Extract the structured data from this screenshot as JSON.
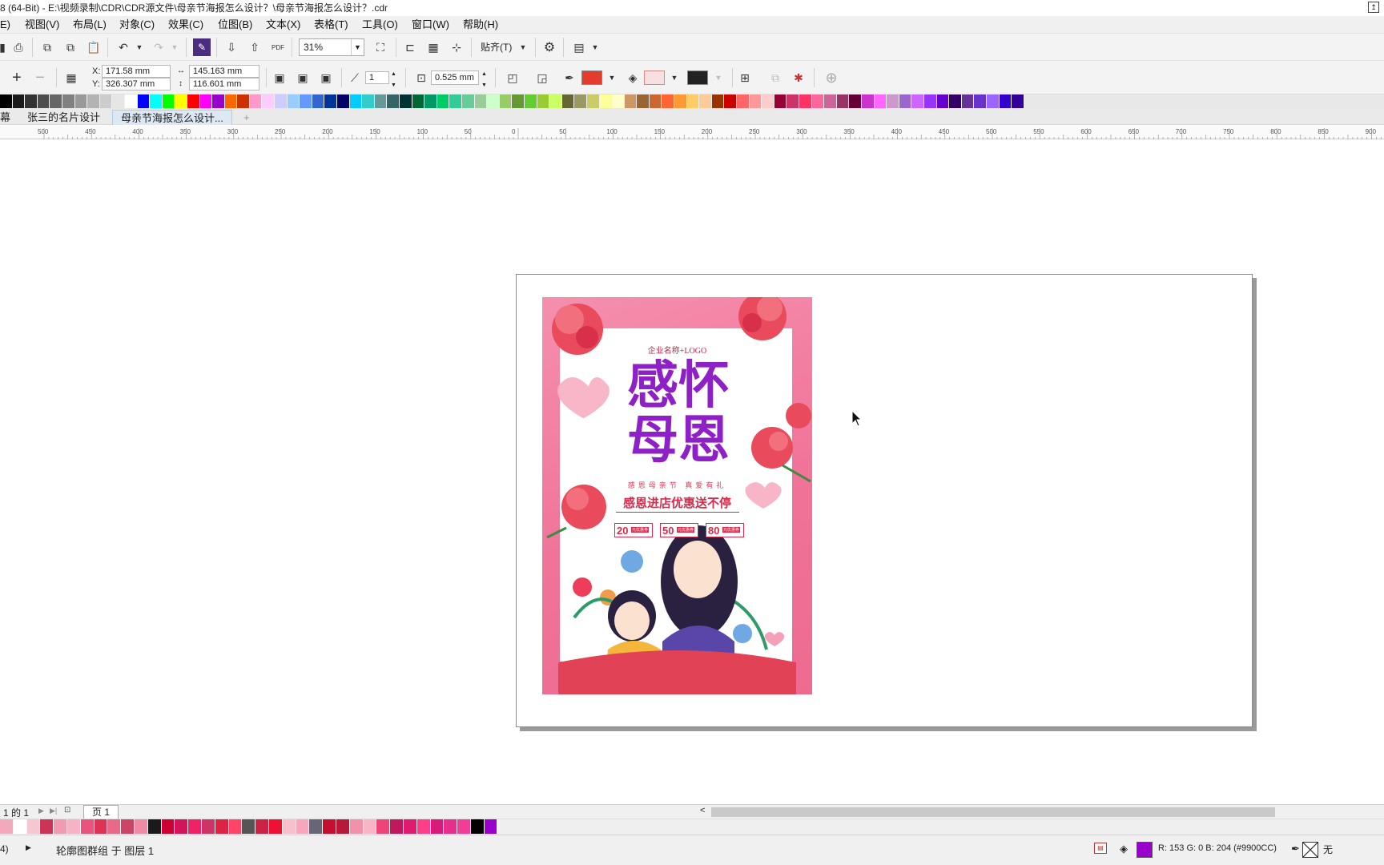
{
  "window": {
    "title": "8 (64-Bit) - E:\\视频录制\\CDR\\CDR源文件\\母亲节海报怎么设计？\\母亲节海报怎么设计？.cdr"
  },
  "menu": [
    "E)",
    "视图(V)",
    "布局(L)",
    "对象(C)",
    "效果(C)",
    "位图(B)",
    "文本(X)",
    "表格(T)",
    "工具(O)",
    "窗口(W)",
    "帮助(H)"
  ],
  "toolbar": {
    "zoom": "31%",
    "snap_label": "贴齐(T)",
    "pdf_label": "PDF"
  },
  "property_bar": {
    "x_label": "X:",
    "x_value": "171.58 mm",
    "y_label": "Y:",
    "y_value": "326.307 mm",
    "width_value": "145.163 mm",
    "height_value": "116.601 mm",
    "spin_value": "1",
    "outline_width": "0.525 mm",
    "fill_color": "#e43b2c",
    "outline_color": "#f4c7c7",
    "extra_color": "#222222"
  },
  "doc_tabs": {
    "tab1": "幕",
    "tab2": "张三的名片设计",
    "tab3": "母亲节海报怎么设计...",
    "add": "+"
  },
  "ruler": [
    "500",
    "450",
    "400",
    "350",
    "300",
    "250",
    "200",
    "150",
    "100",
    "50",
    "0",
    "50",
    "100",
    "150",
    "200",
    "250",
    "300",
    "350",
    "400",
    "450",
    "500",
    "550",
    "600",
    "650",
    "700",
    "750",
    "800",
    "850",
    "900"
  ],
  "poster": {
    "company": "企业名称+LOGO",
    "headline_line1": "感怀",
    "headline_line2": "母恩",
    "subline": "感恩母亲节  真爱有礼",
    "slogan": "感恩进店优惠送不停",
    "coupons": [
      {
        "amount": "20",
        "text": "元优惠券"
      },
      {
        "amount": "50",
        "text": "元优惠券"
      },
      {
        "amount": "80",
        "text": "元优惠券"
      }
    ]
  },
  "page_nav": {
    "page_count": "1 的 1",
    "page_tab": "页 1"
  },
  "status": {
    "left": "4)",
    "message": "轮廓图群组 于 图层 1",
    "color_readout": "R: 153 G: 0 B: 204 (#9900CC)",
    "outline_none": "无",
    "fill_color": "#9900cc"
  },
  "palette_top": [
    "#000000",
    "#1a1a1a",
    "#333333",
    "#4d4d4d",
    "#666666",
    "#808080",
    "#999999",
    "#b3b3b3",
    "#cccccc",
    "#e6e6e6",
    "#ffffff",
    "#0000ff",
    "#00ffff",
    "#00ff00",
    "#ffff00",
    "#ff0000",
    "#ff00ff",
    "#9900cc",
    "#ff6600",
    "#cc3300",
    "#ff99cc",
    "#ffccff",
    "#ccccff",
    "#99ccff",
    "#6699ff",
    "#3366cc",
    "#003399",
    "#000066",
    "#00ccff",
    "#33cccc",
    "#669999",
    "#336666",
    "#003333",
    "#006633",
    "#009966",
    "#00cc66",
    "#33cc99",
    "#66cc99",
    "#99cc99",
    "#ccffcc",
    "#99cc66",
    "#669933",
    "#66cc33",
    "#99cc33",
    "#ccff66",
    "#666633",
    "#999966",
    "#cccc66",
    "#ffff99",
    "#ffffcc",
    "#cc9966",
    "#996633",
    "#cc6633",
    "#ff6633",
    "#ff9933",
    "#ffcc66",
    "#ffcc99",
    "#993300",
    "#cc0000",
    "#ff6666",
    "#ff9999",
    "#ffcccc",
    "#990033",
    "#cc3366",
    "#ff3366",
    "#ff6699",
    "#cc6699",
    "#993366",
    "#660033",
    "#cc33cc",
    "#ff66ff",
    "#cc99cc",
    "#9966cc",
    "#cc66ff",
    "#9933ff",
    "#6600cc",
    "#330066",
    "#663399",
    "#6633cc",
    "#9966ff",
    "#3300cc",
    "#330099"
  ],
  "palette_bottom": [
    "#f4a9b8",
    "#ffffff",
    "#f7c6d3",
    "#cc3355",
    "#f29ab0",
    "#f7b3c6",
    "#e8557a",
    "#dd3355",
    "#e86a88",
    "#cc4466",
    "#f08aa5",
    "#1a1a1a",
    "#cc0033",
    "#d4145a",
    "#ee2266",
    "#cc3366",
    "#dd2244",
    "#ff4466",
    "#555555",
    "#cc2244",
    "#ee1133",
    "#f9c0cc",
    "#f7a6bb",
    "#666677",
    "#c4102e",
    "#b8183a",
    "#f390aa",
    "#f9b5c5",
    "#ee4477",
    "#c0185a",
    "#e01a6e",
    "#ff3d88",
    "#d81b78",
    "#e62e8a",
    "#f23c95",
    "#000000",
    "#9900cc"
  ]
}
